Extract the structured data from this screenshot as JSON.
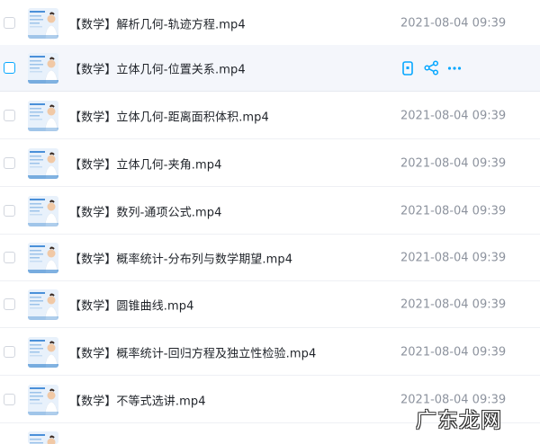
{
  "files": [
    {
      "name": "【数学】解析几何-轨迹方程.mp4",
      "date": "2021-08-04 09:39",
      "hovered": false
    },
    {
      "name": "【数学】立体几何-位置关系.mp4",
      "date": "",
      "hovered": true
    },
    {
      "name": "【数学】立体几何-距离面积体积.mp4",
      "date": "2021-08-04 09:39",
      "hovered": false
    },
    {
      "name": "【数学】立体几何-夹角.mp4",
      "date": "2021-08-04 09:39",
      "hovered": false
    },
    {
      "name": "【数学】数列-通项公式.mp4",
      "date": "2021-08-04 09:39",
      "hovered": false
    },
    {
      "name": "【数学】概率统计-分布列与数学期望.mp4",
      "date": "2021-08-04 09:39",
      "hovered": false
    },
    {
      "name": "【数学】圆锥曲线.mp4",
      "date": "2021-08-04 09:39",
      "hovered": false
    },
    {
      "name": "【数学】概率统计-回归方程及独立性检验.mp4",
      "date": "2021-08-04 09:39",
      "hovered": false
    },
    {
      "name": "【数学】不等式选讲.mp4",
      "date": "2021-08-04 09:39",
      "hovered": false
    },
    {
      "name": "",
      "date": "",
      "hovered": false
    }
  ],
  "hover_actions": [
    "phone-icon",
    "share-icon",
    "more-icon"
  ],
  "watermark": "广东龙网",
  "colors": {
    "accent": "#06a7ff",
    "text": "#1f2329",
    "date": "#8d939e"
  }
}
